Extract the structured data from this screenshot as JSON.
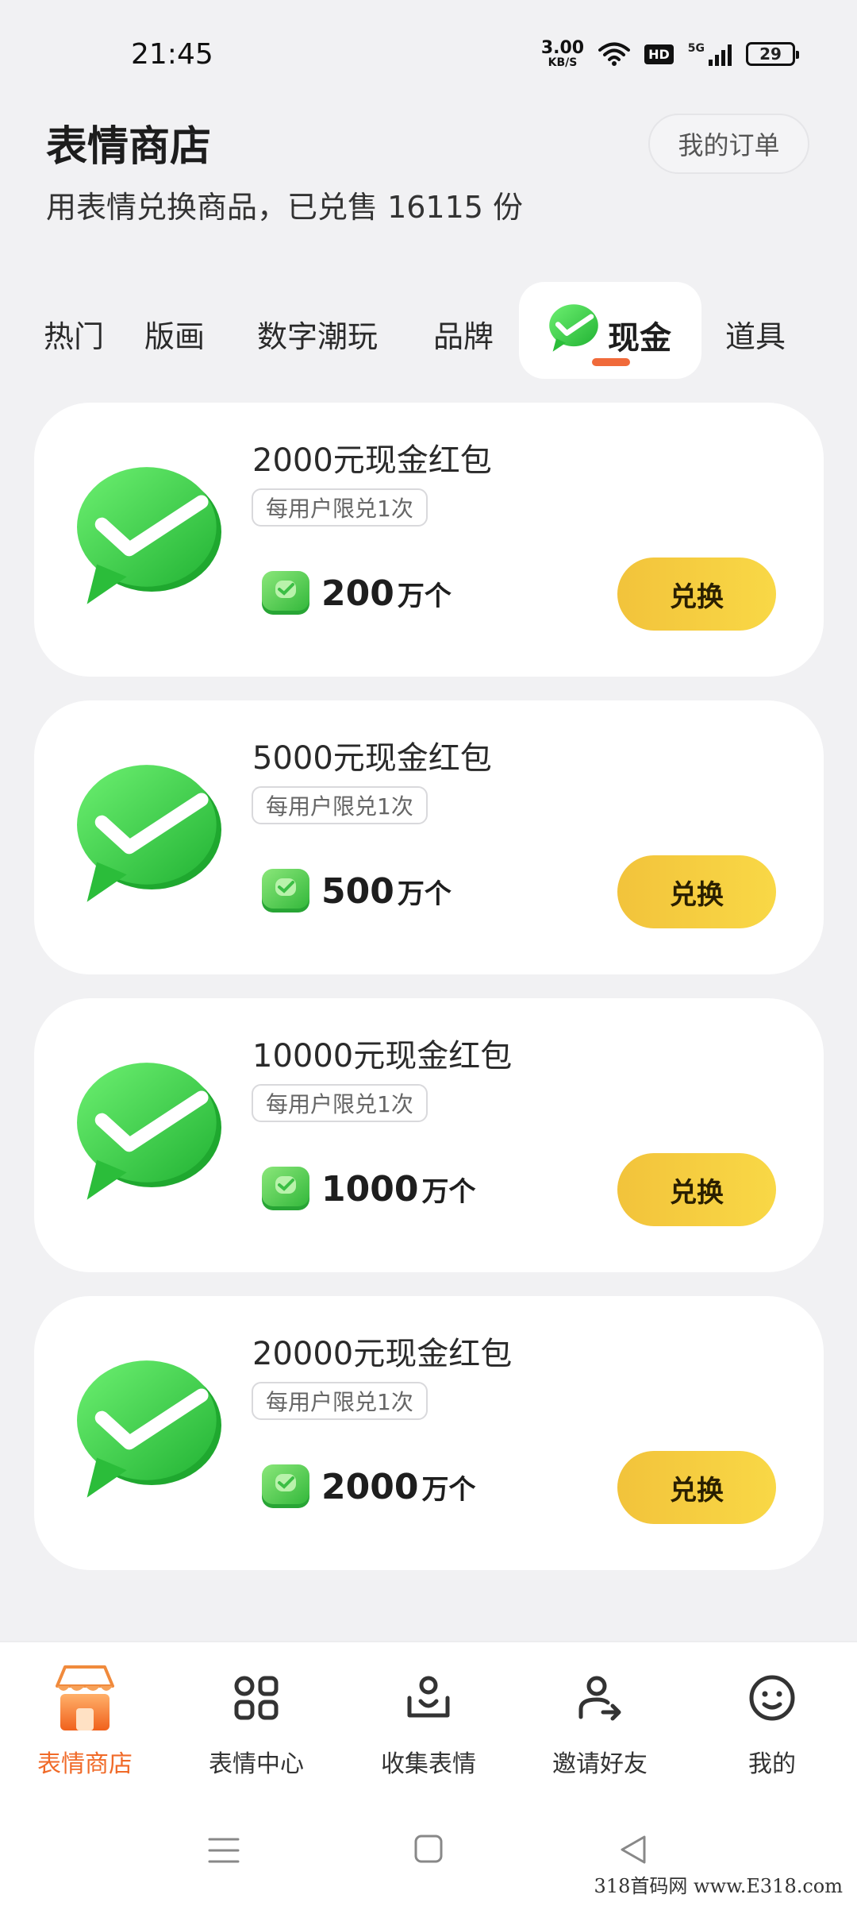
{
  "status": {
    "time": "21:45",
    "net_speed_value": "3.00",
    "net_speed_unit": "KB/S",
    "hd": "HD",
    "network": "5G",
    "battery": "29"
  },
  "header": {
    "title": "表情商店",
    "subtitle": "用表情兑换商品，已兑售 16115 份",
    "orders_label": "我的订单"
  },
  "tabs": [
    {
      "label": "热门"
    },
    {
      "label": "版画"
    },
    {
      "label": "数字潮玩"
    },
    {
      "label": "品牌"
    },
    {
      "label": "现金",
      "active": true
    },
    {
      "label": "道具"
    }
  ],
  "items": [
    {
      "title": "2000元现金红包",
      "limit": "每用户限兑1次",
      "price": "200",
      "unit": "万个",
      "button": "兑换"
    },
    {
      "title": "5000元现金红包",
      "limit": "每用户限兑1次",
      "price": "500",
      "unit": "万个",
      "button": "兑换"
    },
    {
      "title": "10000元现金红包",
      "limit": "每用户限兑1次",
      "price": "1000",
      "unit": "万个",
      "button": "兑换"
    },
    {
      "title": "20000元现金红包",
      "limit": "每用户限兑1次",
      "price": "2000",
      "unit": "万个",
      "button": "兑换"
    }
  ],
  "bottom_nav": [
    {
      "label": "表情商店",
      "icon": "shop-icon",
      "active": true
    },
    {
      "label": "表情中心",
      "icon": "grid-icon"
    },
    {
      "label": "收集表情",
      "icon": "collect-icon"
    },
    {
      "label": "邀请好友",
      "icon": "invite-icon"
    },
    {
      "label": "我的",
      "icon": "smiley-icon"
    }
  ],
  "watermark": "318首码网 www.E318.com",
  "colors": {
    "accent": "#f06a28",
    "button": "#f6cd40",
    "green": "#3fd64b",
    "background": "#f1f1f3"
  }
}
